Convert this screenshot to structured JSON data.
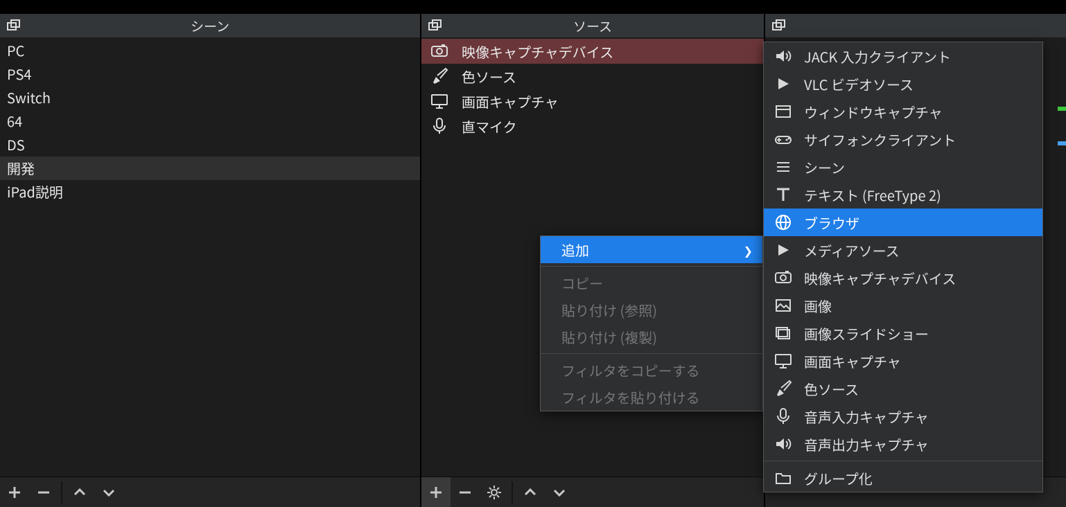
{
  "panels": {
    "scenes": {
      "title": "シーン"
    },
    "sources": {
      "title": "ソース"
    },
    "mixer": {
      "title": ""
    }
  },
  "scenes": [
    {
      "label": "PC"
    },
    {
      "label": "PS4"
    },
    {
      "label": "Switch"
    },
    {
      "label": "64"
    },
    {
      "label": "DS"
    },
    {
      "label": "開発"
    },
    {
      "label": "iPad説明"
    }
  ],
  "sources": [
    {
      "label": "映像キャプチャデバイス",
      "icon": "camera"
    },
    {
      "label": "色ソース",
      "icon": "brush"
    },
    {
      "label": "画面キャプチャ",
      "icon": "monitor"
    },
    {
      "label": "直マイク",
      "icon": "mic"
    }
  ],
  "ctx": {
    "add": "追加",
    "copy": "コピー",
    "paste_ref": "貼り付け (参照)",
    "paste_dup": "貼り付け (複製)",
    "copy_filters": "フィルタをコピーする",
    "paste_filters": "フィルタを貼り付ける"
  },
  "submenu": {
    "jack": "JACK 入力クライアント",
    "vlc": "VLC ビデオソース",
    "window_capture": "ウィンドウキャプチャ",
    "syphon": "サイフォンクライアント",
    "scene": "シーン",
    "text_ft2": "テキスト (FreeType 2)",
    "browser": "ブラウザ",
    "media": "メディアソース",
    "video_capture": "映像キャプチャデバイス",
    "image": "画像",
    "slideshow": "画像スライドショー",
    "display_capture": "画面キャプチャ",
    "color": "色ソース",
    "audio_in": "音声入力キャプチャ",
    "audio_out": "音声出力キャプチャ",
    "group": "グループ化"
  }
}
